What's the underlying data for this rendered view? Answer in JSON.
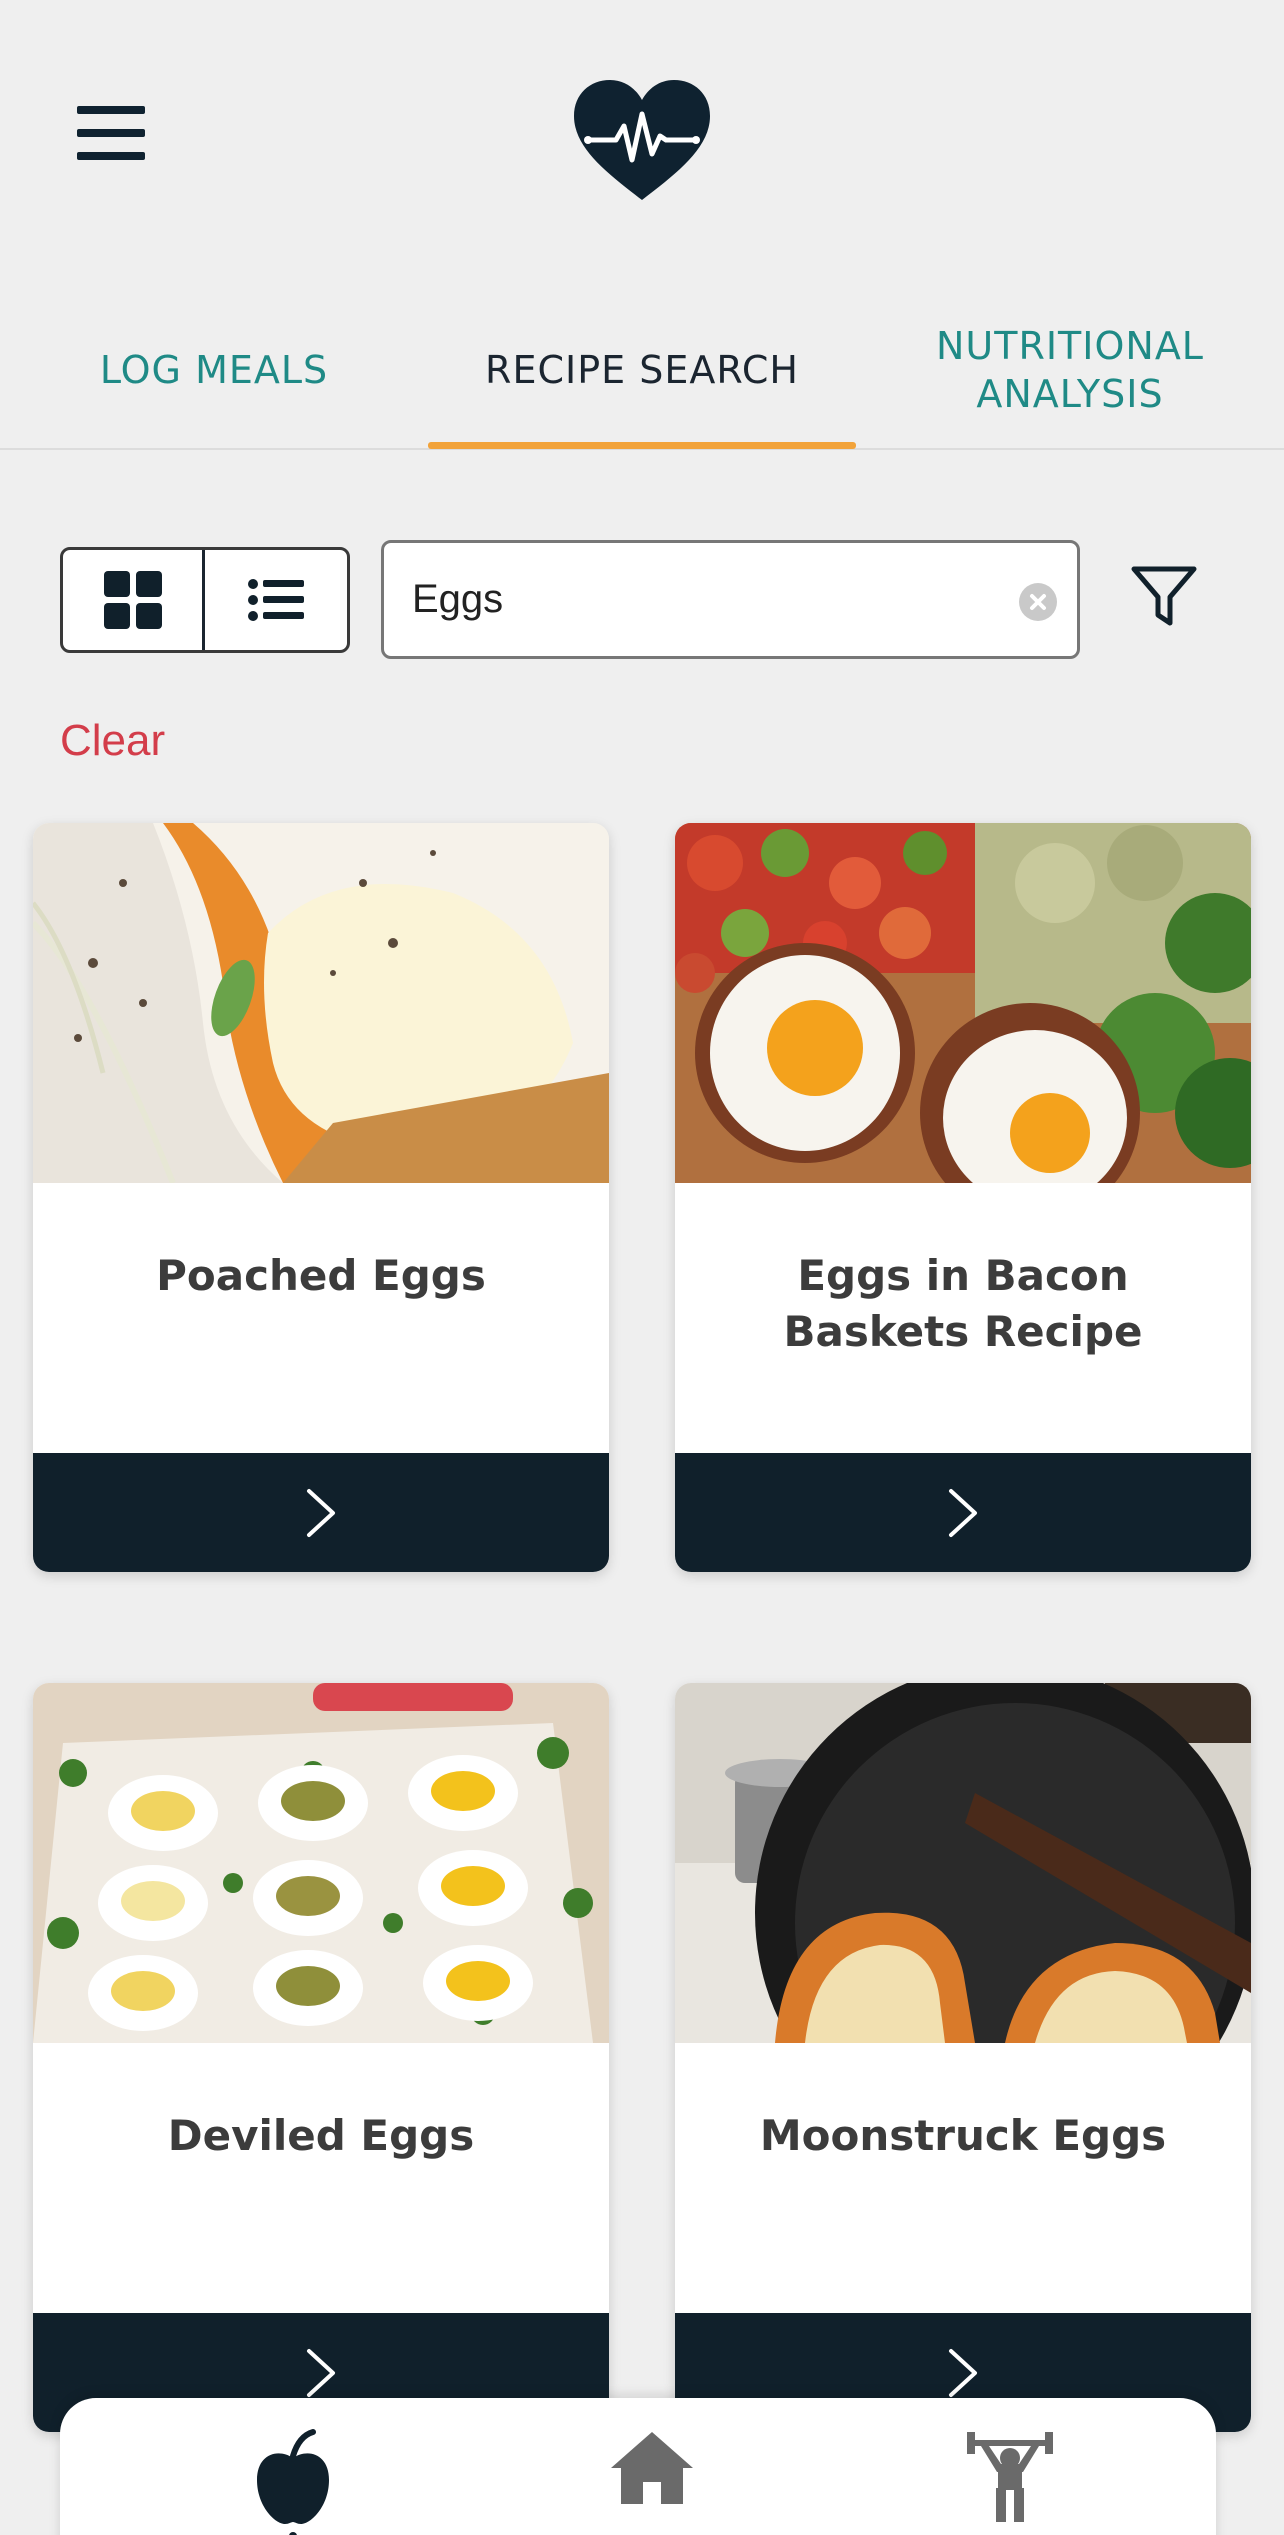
{
  "header": {
    "logo_icon": "heart-pulse-icon",
    "menu_icon": "hamburger-menu-icon"
  },
  "tabs": [
    {
      "label": "LOG MEALS",
      "active": false
    },
    {
      "label": "RECIPE SEARCH",
      "active": true
    },
    {
      "label": "NUTRITIONAL ANALYSIS",
      "active": false
    }
  ],
  "toolbar": {
    "grid_view_icon": "grid-view-icon",
    "list_view_icon": "list-view-icon",
    "active_view": "grid",
    "search_value": "Eggs",
    "filter_icon": "filter-icon",
    "clear_label": "Clear"
  },
  "recipes": [
    {
      "title": "Poached Eggs",
      "image": "poached-eggs-photo"
    },
    {
      "title": "Eggs in Bacon Baskets Recipe",
      "image": "eggs-in-bacon-baskets-photo"
    },
    {
      "title": "Deviled Eggs",
      "image": "deviled-eggs-photo"
    },
    {
      "title": "Moonstruck Eggs",
      "image": "moonstruck-eggs-photo"
    }
  ],
  "bottom_nav": [
    {
      "icon": "apple-icon",
      "active": true
    },
    {
      "icon": "home-icon",
      "active": false
    },
    {
      "icon": "weightlifter-icon",
      "active": false
    }
  ],
  "colors": {
    "accent": "#f2a33a",
    "teal": "#1f8a86",
    "dark": "#10202b",
    "clear_red": "#d33d4a"
  }
}
